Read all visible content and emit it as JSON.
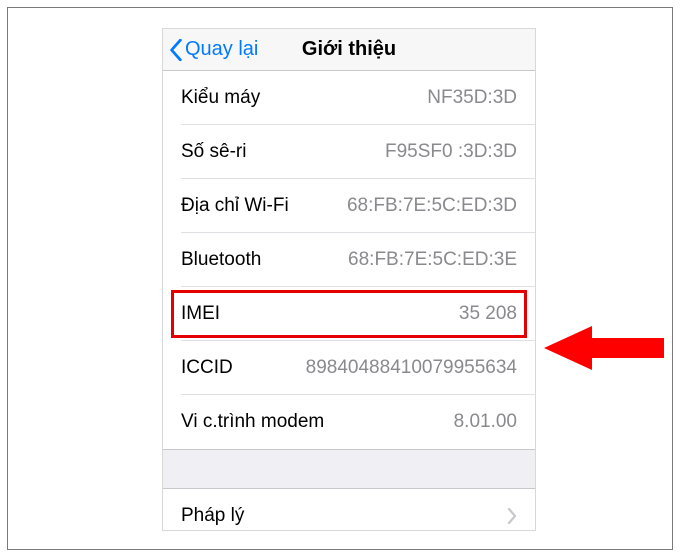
{
  "nav": {
    "back_label": "Quay lại",
    "title": "Giới thiệu"
  },
  "rows": [
    {
      "label": "Kiểu máy",
      "value": "NF35D:3D"
    },
    {
      "label": "Số sê-ri",
      "value": "F95SF0 :3D:3D"
    },
    {
      "label": "Địa chỉ Wi-Fi",
      "value": "68:FB:7E:5C:ED:3D"
    },
    {
      "label": "Bluetooth",
      "value": "68:FB:7E:5C:ED:3E"
    },
    {
      "label": "IMEI",
      "value": "35 208"
    },
    {
      "label": "ICCID",
      "value": "89840488410079955634"
    },
    {
      "label": "Vi c.trình modem",
      "value": "8.01.00"
    }
  ],
  "legal": {
    "label": "Pháp lý"
  },
  "highlight": {
    "row_index": 4,
    "color": "#e40000"
  }
}
